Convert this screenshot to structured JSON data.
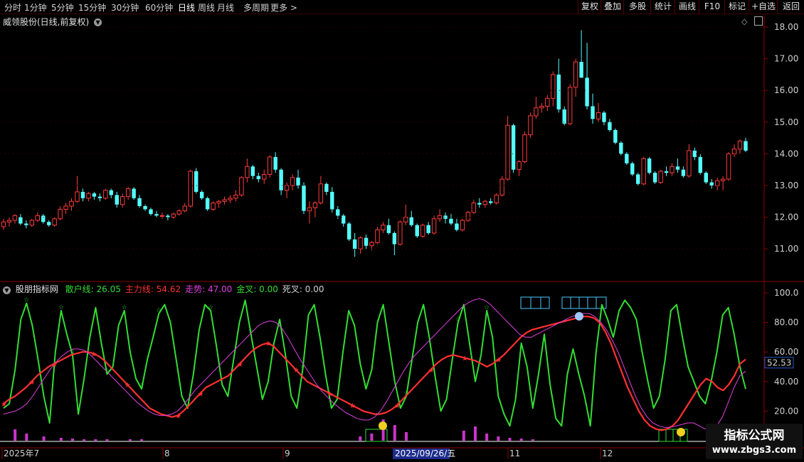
{
  "toolbar": {
    "timeframes": [
      "分时",
      "1分钟",
      "5分钟",
      "15分钟",
      "30分钟",
      "60分钟",
      "日线",
      "周线",
      "月线",
      "多周期",
      "更多 >"
    ],
    "active_timeframe": "日线",
    "right_buttons": [
      "复权",
      "叠加",
      "多股",
      "统计",
      "画线",
      "F10",
      "标记",
      "+自选",
      "返回"
    ]
  },
  "chart_title": "威领股份(日线,前复权)",
  "price_axis": {
    "labels": [
      "18.00",
      "17.00",
      "16.00",
      "15.00",
      "14.00",
      "13.00",
      "12.00",
      "11.00"
    ],
    "values": [
      18,
      17,
      16,
      15,
      14,
      13,
      12,
      11
    ]
  },
  "indicator": {
    "name": "股朋指标网",
    "items": [
      {
        "label": "散户线: 26.05",
        "color": "#33dd33"
      },
      {
        "label": "主力线: 54.62",
        "color": "#ff3030"
      },
      {
        "label": "走势: 47.00",
        "color": "#e040e0"
      },
      {
        "label": "金叉: 0.00",
        "color": "#33dd33"
      },
      {
        "label": "死叉: 0.00",
        "color": "#d0d0d0"
      }
    ],
    "axis_labels": [
      "100.0",
      "80.00",
      "60.00",
      "40.00",
      "20.00"
    ],
    "axis_values": [
      100,
      80,
      60,
      40,
      20
    ],
    "current_value": "52.53"
  },
  "date_axis": {
    "labels": [
      "2025年7",
      "8",
      "9",
      "11",
      "12"
    ],
    "cursor_date": "2025/09/26/五"
  },
  "watermark": {
    "line1": "指标公式网",
    "line2": "www.zbgs3.com"
  },
  "chart_data": {
    "type": "candlestick",
    "title": "威领股份(日线,前复权)",
    "ylim": [
      10.5,
      18.3
    ],
    "candles": [
      [
        11.7,
        11.95,
        11.6,
        11.85
      ],
      [
        11.85,
        12.0,
        11.7,
        11.9
      ],
      [
        11.9,
        12.1,
        11.8,
        12.05
      ],
      [
        12.0,
        12.1,
        11.75,
        11.8
      ],
      [
        11.8,
        11.9,
        11.65,
        11.75
      ],
      [
        11.75,
        11.95,
        11.7,
        11.9
      ],
      [
        11.9,
        12.15,
        11.85,
        12.05
      ],
      [
        12.05,
        12.1,
        11.8,
        11.85
      ],
      [
        11.85,
        11.9,
        11.7,
        11.75
      ],
      [
        11.75,
        12.0,
        11.7,
        11.95
      ],
      [
        11.95,
        12.35,
        11.9,
        12.25
      ],
      [
        12.25,
        12.45,
        12.1,
        12.35
      ],
      [
        12.35,
        12.6,
        12.2,
        12.5
      ],
      [
        12.5,
        13.3,
        12.45,
        12.8
      ],
      [
        12.8,
        12.9,
        12.5,
        12.6
      ],
      [
        12.6,
        12.8,
        12.5,
        12.75
      ],
      [
        12.75,
        12.8,
        12.55,
        12.65
      ],
      [
        12.65,
        12.75,
        12.5,
        12.6
      ],
      [
        12.6,
        12.9,
        12.55,
        12.85
      ],
      [
        12.85,
        12.9,
        12.6,
        12.7
      ],
      [
        12.7,
        12.8,
        12.3,
        12.4
      ],
      [
        12.4,
        12.75,
        12.3,
        12.65
      ],
      [
        12.65,
        12.95,
        12.55,
        12.9
      ],
      [
        12.9,
        12.95,
        12.55,
        12.6
      ],
      [
        12.6,
        12.7,
        12.3,
        12.35
      ],
      [
        12.35,
        12.4,
        12.2,
        12.25
      ],
      [
        12.25,
        12.3,
        12.05,
        12.1
      ],
      [
        12.1,
        12.2,
        12.0,
        12.05
      ],
      [
        12.05,
        12.15,
        11.95,
        12.05
      ],
      [
        12.05,
        12.1,
        11.9,
        12.0
      ],
      [
        12.0,
        12.15,
        11.95,
        12.1
      ],
      [
        12.1,
        12.25,
        12.05,
        12.2
      ],
      [
        12.2,
        12.45,
        12.15,
        12.35
      ],
      [
        12.35,
        13.5,
        12.3,
        13.45
      ],
      [
        13.45,
        13.55,
        12.75,
        12.8
      ],
      [
        12.8,
        12.85,
        12.55,
        12.6
      ],
      [
        12.6,
        12.65,
        12.2,
        12.25
      ],
      [
        12.25,
        12.5,
        12.2,
        12.45
      ],
      [
        12.45,
        12.55,
        12.3,
        12.5
      ],
      [
        12.5,
        12.65,
        12.4,
        12.55
      ],
      [
        12.55,
        12.7,
        12.45,
        12.6
      ],
      [
        12.6,
        12.85,
        12.5,
        12.7
      ],
      [
        12.7,
        13.3,
        12.65,
        13.25
      ],
      [
        13.25,
        13.85,
        13.1,
        13.6
      ],
      [
        13.6,
        13.65,
        13.2,
        13.3
      ],
      [
        13.3,
        13.4,
        13.1,
        13.2
      ],
      [
        13.2,
        13.5,
        13.05,
        13.35
      ],
      [
        13.35,
        13.95,
        13.25,
        13.9
      ],
      [
        13.9,
        14.05,
        13.4,
        13.5
      ],
      [
        13.5,
        13.55,
        12.7,
        12.85
      ],
      [
        12.85,
        13.1,
        12.6,
        13.0
      ],
      [
        13.0,
        13.35,
        12.85,
        13.25
      ],
      [
        13.25,
        13.5,
        12.9,
        13.0
      ],
      [
        13.0,
        13.1,
        12.1,
        12.2
      ],
      [
        12.2,
        12.5,
        11.8,
        12.3
      ],
      [
        12.3,
        12.5,
        12.0,
        12.45
      ],
      [
        12.45,
        13.3,
        12.4,
        13.05
      ],
      [
        13.05,
        13.1,
        12.7,
        12.8
      ],
      [
        12.8,
        12.95,
        12.15,
        12.25
      ],
      [
        12.25,
        12.35,
        11.95,
        12.05
      ],
      [
        12.05,
        12.1,
        11.7,
        11.8
      ],
      [
        11.8,
        11.85,
        11.25,
        11.3
      ],
      [
        11.3,
        11.5,
        10.75,
        11.0
      ],
      [
        11.0,
        11.4,
        10.85,
        11.35
      ],
      [
        11.35,
        11.45,
        11.0,
        11.1
      ],
      [
        11.1,
        11.25,
        10.95,
        11.2
      ],
      [
        11.2,
        11.7,
        11.15,
        11.6
      ],
      [
        11.6,
        11.85,
        11.5,
        11.75
      ],
      [
        11.75,
        11.95,
        11.45,
        11.5
      ],
      [
        11.5,
        11.55,
        10.8,
        11.15
      ],
      [
        11.15,
        11.9,
        11.1,
        11.85
      ],
      [
        11.85,
        12.4,
        11.75,
        12.0
      ],
      [
        12.0,
        12.2,
        11.7,
        11.75
      ],
      [
        11.75,
        11.8,
        11.35,
        11.4
      ],
      [
        11.4,
        11.8,
        11.35,
        11.75
      ],
      [
        11.75,
        11.85,
        11.45,
        11.5
      ],
      [
        11.5,
        12.05,
        11.45,
        11.95
      ],
      [
        11.95,
        12.25,
        11.85,
        12.05
      ],
      [
        12.05,
        12.15,
        11.8,
        11.95
      ],
      [
        11.95,
        12.1,
        11.75,
        11.8
      ],
      [
        11.8,
        11.95,
        11.55,
        11.6
      ],
      [
        11.6,
        11.95,
        11.55,
        11.9
      ],
      [
        11.9,
        12.2,
        11.85,
        12.15
      ],
      [
        12.15,
        12.55,
        12.1,
        12.45
      ],
      [
        12.45,
        12.6,
        12.3,
        12.4
      ],
      [
        12.4,
        12.55,
        12.3,
        12.5
      ],
      [
        12.5,
        12.6,
        12.4,
        12.45
      ],
      [
        12.45,
        12.75,
        12.4,
        12.7
      ],
      [
        12.7,
        13.3,
        12.65,
        13.2
      ],
      [
        13.2,
        15.2,
        13.15,
        14.9
      ],
      [
        14.9,
        14.95,
        13.4,
        13.5
      ],
      [
        13.5,
        13.8,
        13.3,
        13.75
      ],
      [
        13.75,
        14.7,
        13.7,
        14.6
      ],
      [
        14.6,
        15.3,
        14.5,
        15.2
      ],
      [
        15.2,
        15.8,
        15.1,
        15.45
      ],
      [
        15.45,
        15.6,
        15.3,
        15.5
      ],
      [
        15.5,
        15.85,
        15.35,
        15.75
      ],
      [
        15.75,
        16.6,
        15.5,
        16.5
      ],
      [
        16.5,
        17.0,
        15.3,
        15.4
      ],
      [
        15.4,
        15.5,
        14.9,
        14.95
      ],
      [
        14.95,
        16.2,
        14.9,
        16.1
      ],
      [
        16.1,
        17.0,
        15.8,
        16.9
      ],
      [
        16.9,
        17.9,
        16.4,
        16.4
      ],
      [
        16.4,
        17.5,
        15.4,
        15.5
      ],
      [
        15.5,
        15.9,
        14.95,
        15.1
      ],
      [
        15.1,
        15.6,
        15.0,
        15.3
      ],
      [
        15.3,
        15.35,
        14.9,
        15.0
      ],
      [
        15.0,
        15.1,
        14.7,
        14.75
      ],
      [
        14.75,
        14.8,
        14.3,
        14.35
      ],
      [
        14.35,
        14.4,
        13.95,
        14.0
      ],
      [
        14.0,
        14.05,
        13.65,
        13.7
      ],
      [
        13.7,
        13.75,
        13.3,
        13.35
      ],
      [
        13.35,
        13.4,
        13.0,
        13.05
      ],
      [
        13.05,
        13.9,
        13.0,
        13.85
      ],
      [
        13.85,
        13.9,
        13.35,
        13.4
      ],
      [
        13.4,
        13.45,
        13.05,
        13.1
      ],
      [
        13.1,
        13.5,
        13.05,
        13.45
      ],
      [
        13.45,
        13.6,
        13.3,
        13.4
      ],
      [
        13.4,
        13.7,
        13.3,
        13.6
      ],
      [
        13.6,
        13.85,
        13.4,
        13.5
      ],
      [
        13.5,
        13.6,
        13.25,
        13.3
      ],
      [
        13.3,
        14.3,
        13.25,
        14.1
      ],
      [
        14.1,
        14.2,
        13.8,
        13.9
      ],
      [
        13.9,
        14.0,
        13.35,
        13.4
      ],
      [
        13.4,
        13.45,
        13.05,
        13.1
      ],
      [
        13.1,
        13.2,
        12.9,
        13.0
      ],
      [
        13.0,
        13.25,
        12.85,
        13.15
      ],
      [
        13.15,
        13.3,
        12.85,
        13.2
      ],
      [
        13.2,
        14.05,
        13.15,
        14.0
      ],
      [
        14.0,
        14.3,
        13.9,
        14.15
      ],
      [
        14.15,
        14.45,
        14.0,
        14.4
      ],
      [
        14.4,
        14.5,
        14.05,
        14.1
      ]
    ],
    "indicator_series": [
      {
        "name": "散户线",
        "color": "#33dd33",
        "values": [
          22,
          25,
          48,
          82,
          93,
          78,
          55,
          30,
          12,
          60,
          88,
          72,
          58,
          18,
          42,
          70,
          90,
          66,
          45,
          50,
          78,
          88,
          60,
          42,
          35,
          55,
          70,
          86,
          92,
          80,
          55,
          30,
          22,
          45,
          75,
          92,
          88,
          64,
          38,
          30,
          55,
          80,
          95,
          72,
          50,
          28,
          40,
          66,
          82,
          58,
          30,
          22,
          48,
          85,
          92,
          70,
          44,
          22,
          28,
          60,
          88,
          78,
          52,
          35,
          48,
          80,
          92,
          66,
          40,
          22,
          30,
          55,
          80,
          92,
          70,
          44,
          20,
          28,
          55,
          80,
          92,
          66,
          40,
          58,
          88,
          70,
          30,
          18,
          10,
          28,
          66,
          50,
          22,
          45,
          72,
          38,
          15,
          10,
          45,
          62,
          45,
          30,
          10,
          60,
          92,
          82,
          70,
          88,
          95,
          90,
          82,
          60,
          40,
          22,
          30,
          55,
          88,
          92,
          70,
          50,
          40,
          30,
          25,
          40,
          60,
          85,
          90,
          72,
          50,
          35
        ]
      },
      {
        "name": "主力线",
        "color": "#ff3030",
        "values": [
          25,
          28,
          30,
          33,
          36,
          40,
          44,
          47,
          50,
          52,
          54,
          56,
          58,
          59,
          60,
          60,
          59,
          57,
          54,
          50,
          46,
          42,
          38,
          34,
          30,
          26,
          22,
          20,
          18,
          17,
          16,
          17,
          20,
          24,
          28,
          32,
          36,
          38,
          40,
          42,
          44,
          48,
          52,
          56,
          60,
          63,
          65,
          66,
          64,
          60,
          56,
          52,
          48,
          44,
          40,
          38,
          36,
          34,
          32,
          30,
          28,
          26,
          24,
          22,
          20,
          19,
          18,
          18,
          19,
          21,
          24,
          28,
          32,
          36,
          40,
          44,
          48,
          52,
          55,
          57,
          58,
          57,
          56,
          55,
          54,
          52,
          50,
          52,
          55,
          58,
          62,
          66,
          70,
          73,
          75,
          76,
          77,
          78,
          79,
          80,
          81,
          82,
          83,
          84,
          84,
          83,
          80,
          74,
          66,
          56,
          46,
          36,
          28,
          20,
          14,
          10,
          8,
          7,
          8,
          10,
          14,
          20,
          26,
          32,
          38,
          42,
          40,
          36,
          34,
          38,
          44,
          52,
          55
        ]
      },
      {
        "name": "走势",
        "color": "#e040e0",
        "values": [
          18,
          19,
          20,
          22,
          25,
          30,
          36,
          42,
          48,
          53,
          57,
          60,
          62,
          62,
          61,
          58,
          54,
          50,
          46,
          42,
          38,
          34,
          30,
          26,
          23,
          20,
          18,
          17,
          17,
          18,
          20,
          24,
          29,
          34,
          38,
          42,
          46,
          50,
          54,
          58,
          62,
          66,
          70,
          74,
          78,
          80,
          81,
          80,
          76,
          70,
          63,
          56,
          50,
          44,
          38,
          33,
          29,
          25,
          22,
          19,
          17,
          15,
          14,
          14,
          16,
          20,
          26,
          33,
          40,
          47,
          53,
          58,
          62,
          66,
          70,
          74,
          78,
          82,
          86,
          90,
          93,
          95,
          96,
          95,
          92,
          88,
          84,
          80,
          76,
          72,
          70,
          70,
          72,
          74,
          76,
          78,
          80,
          82,
          84,
          85,
          86,
          86,
          84,
          80,
          75,
          68,
          60,
          50,
          40,
          30,
          22,
          16,
          12,
          10,
          9,
          9,
          10,
          11,
          12,
          12,
          10,
          8,
          8,
          10,
          16,
          26,
          36,
          44,
          47
        ]
      }
    ],
    "date_labels": [
      "2025年7",
      "8",
      "9",
      "11",
      "12"
    ]
  }
}
